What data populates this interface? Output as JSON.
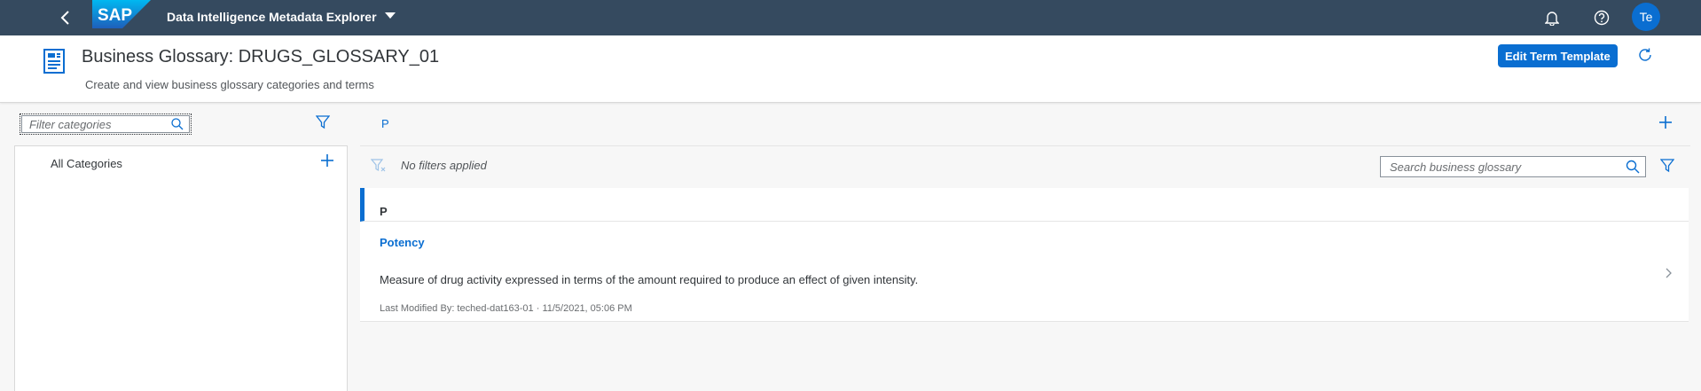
{
  "shell": {
    "logo_text": "SAP",
    "app_title": "Data Intelligence Metadata Explorer",
    "avatar_initials": "Te",
    "icons": [
      "back-icon",
      "dropdown-caret-icon",
      "bell-icon",
      "help-icon"
    ]
  },
  "header": {
    "title": "Business Glossary: DRUGS_GLOSSARY_01",
    "subtitle": "Create and view business glossary categories and terms",
    "edit_button_label": "Edit Term Template",
    "icons": [
      "glossary-icon",
      "refresh-icon"
    ]
  },
  "left_pane": {
    "filter_placeholder": "Filter categories",
    "tree": [
      {
        "label": "All Categories"
      }
    ],
    "icons": [
      "search-icon",
      "filter-icon",
      "add-icon"
    ]
  },
  "right_pane": {
    "breadcrumb": "P",
    "filter_status": "No filters applied",
    "search_placeholder": "Search business glossary",
    "groups": [
      {
        "letter": "P",
        "terms": [
          {
            "name": "Potency",
            "description": "Measure of drug activity expressed in terms of the amount required to produce an effect of given intensity.",
            "meta": "Last Modified By: teched-dat163-01  ·  11/5/2021, 05:06 PM"
          }
        ]
      }
    ],
    "icons": [
      "add-icon",
      "clear-filter-icon",
      "search-icon",
      "filter-icon",
      "chevron-right-icon"
    ]
  },
  "colors": {
    "shell_bg": "#354a5f",
    "accent": "#0a6ed1",
    "page_bg": "#f7f7f7"
  }
}
